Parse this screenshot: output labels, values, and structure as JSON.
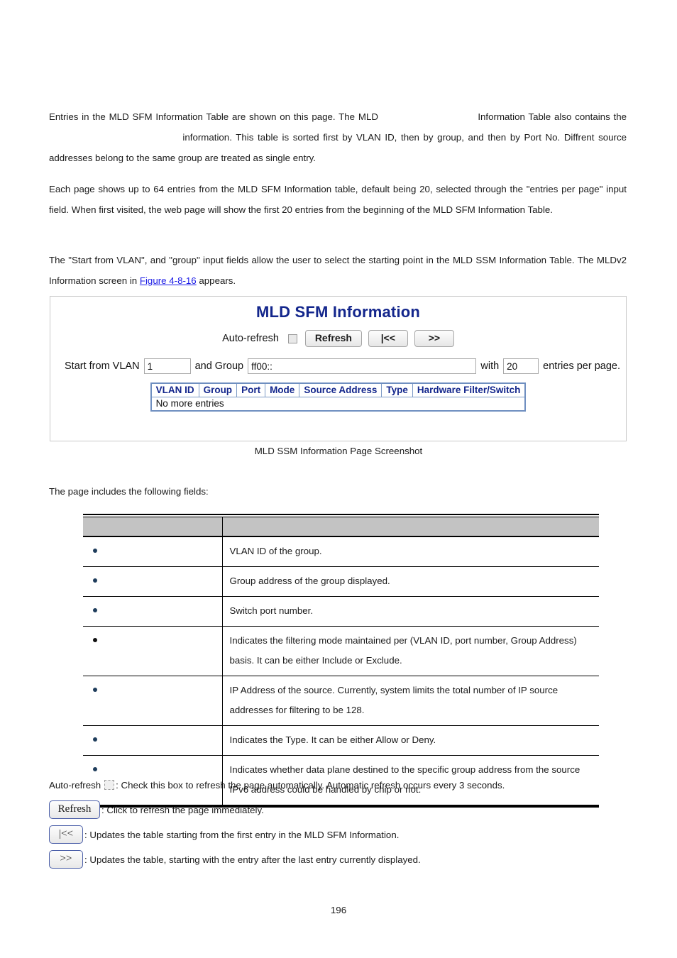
{
  "document": {
    "page_number": "196",
    "paragraphs": {
      "p1_a": "Entries in the MLD SFM Information Table are shown on this page. The MLD",
      "p1_gap1": "                                      ",
      "p1_b": "Information Table also contains the",
      "p1_gap2": "                                                   ",
      "p1_c": "information. This table is sorted first by VLAN ID, then by group, and then by Port No. Diffrent source addresses belong to the same group are treated as single entry.",
      "p2": "Each page shows up to 64 entries from the MLD SFM Information table, default being 20, selected through the \"entries per page\" input field. When first visited, the web page will show the first 20 entries from the beginning of the MLD SFM Information Table.",
      "p3_a": "The \"Start from VLAN\", and \"group\" input fields allow the user to select the starting point in the MLD SSM Information Table. The MLDv2 Information screen in ",
      "p3_link": "Figure 4-8-16",
      "p3_b": " appears."
    },
    "figure_caption": "MLD SSM Information Page Screenshot",
    "lead_in": "The page includes the following fields:"
  },
  "screenshot": {
    "title": "MLD SFM Information",
    "toolbar": {
      "auto_refresh_label": "Auto-refresh",
      "refresh_label": "Refresh",
      "first_label": "|<<",
      "next_label": ">>"
    },
    "filter": {
      "start_from_vlan_label": "Start from VLAN",
      "vlan_value": "1",
      "and_group_label": "and Group",
      "group_value": "ff00::",
      "with_label": "with",
      "entries_value": "20",
      "entries_per_page_label": "entries per page."
    },
    "table": {
      "headers": [
        "VLAN ID",
        "Group",
        "Port",
        "Mode",
        "Source Address",
        "Type",
        "Hardware Filter/Switch"
      ],
      "empty_message": "No more entries"
    }
  },
  "fields_table": {
    "header": {
      "object_col": "",
      "description_col": ""
    },
    "rows": [
      {
        "label": "",
        "description": "VLAN ID of the group."
      },
      {
        "label": "",
        "description": "Group address of the group displayed."
      },
      {
        "label": "",
        "description": "Switch port number."
      },
      {
        "label": "",
        "description": "Indicates the filtering mode maintained per (VLAN ID, port number, Group Address) basis. It can be either Include or Exclude."
      },
      {
        "label": "",
        "description": "IP Address of the source. Currently, system limits the total number of IP source addresses for filtering to be 128."
      },
      {
        "label": "",
        "description": "Indicates the Type. It can be either Allow or Deny."
      },
      {
        "label": "",
        "description": "Indicates whether data plane destined to the specific group address from the source IPv6 address could be handled by chip or not."
      }
    ]
  },
  "legend": {
    "auto_refresh_label": "Auto-refresh",
    "auto_refresh_desc": ": Check this box to refresh the page automatically. Automatic refresh occurs every 3 seconds.",
    "refresh_button": "Refresh",
    "refresh_desc": ": Click to refresh the page immediately.",
    "first_button": "|<<",
    "first_desc": ": Updates the table starting from the first entry in the MLD SFM Information.",
    "next_button": ">>",
    "next_desc": ": Updates the table, starting with the entry after the last entry currently displayed."
  },
  "colors": {
    "title_blue": "#13268c",
    "link_blue": "#1a1ae6",
    "header_gray": "#c3c3c3",
    "bullet_navy": "#1f3d5c"
  }
}
